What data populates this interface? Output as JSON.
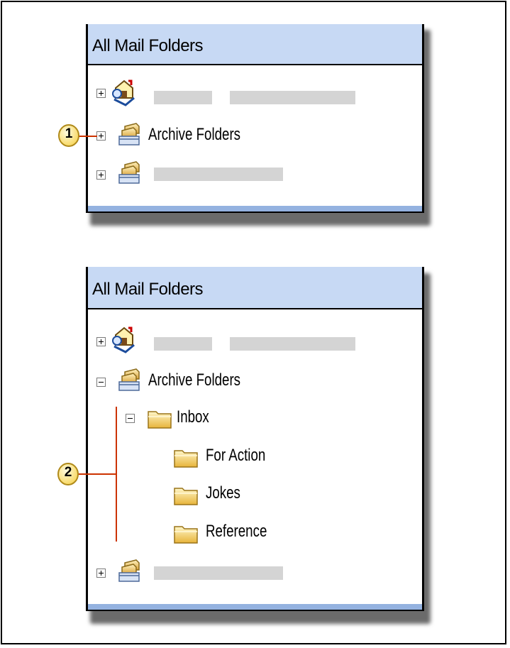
{
  "top_panel": {
    "header": "All Mail Folders",
    "rows": [
      {
        "expander": "plus",
        "icon": "mailbox-icon",
        "label": ""
      },
      {
        "expander": "plus",
        "icon": "archive-icon",
        "label": "Archive Folders"
      },
      {
        "expander": "plus",
        "icon": "archive-icon",
        "label": ""
      }
    ]
  },
  "bottom_panel": {
    "header": "All Mail Folders",
    "rows": [
      {
        "expander": "plus",
        "icon": "mailbox-icon",
        "label": ""
      },
      {
        "expander": "minus",
        "icon": "archive-icon",
        "label": "Archive Folders"
      },
      {
        "expander": "minus",
        "icon": "folder-icon",
        "label": "Inbox"
      },
      {
        "expander": "none",
        "icon": "folder-icon",
        "label": "For Action"
      },
      {
        "expander": "none",
        "icon": "folder-icon",
        "label": "Jokes"
      },
      {
        "expander": "none",
        "icon": "folder-icon",
        "label": "Reference"
      },
      {
        "expander": "plus",
        "icon": "archive-icon",
        "label": ""
      }
    ]
  },
  "callouts": [
    "1",
    "2"
  ],
  "colors": {
    "header_bg": "#c7d9f4",
    "footer_bg": "#94b2e0",
    "callout_fill": "#fde98a",
    "callout_line": "#cc3300"
  }
}
